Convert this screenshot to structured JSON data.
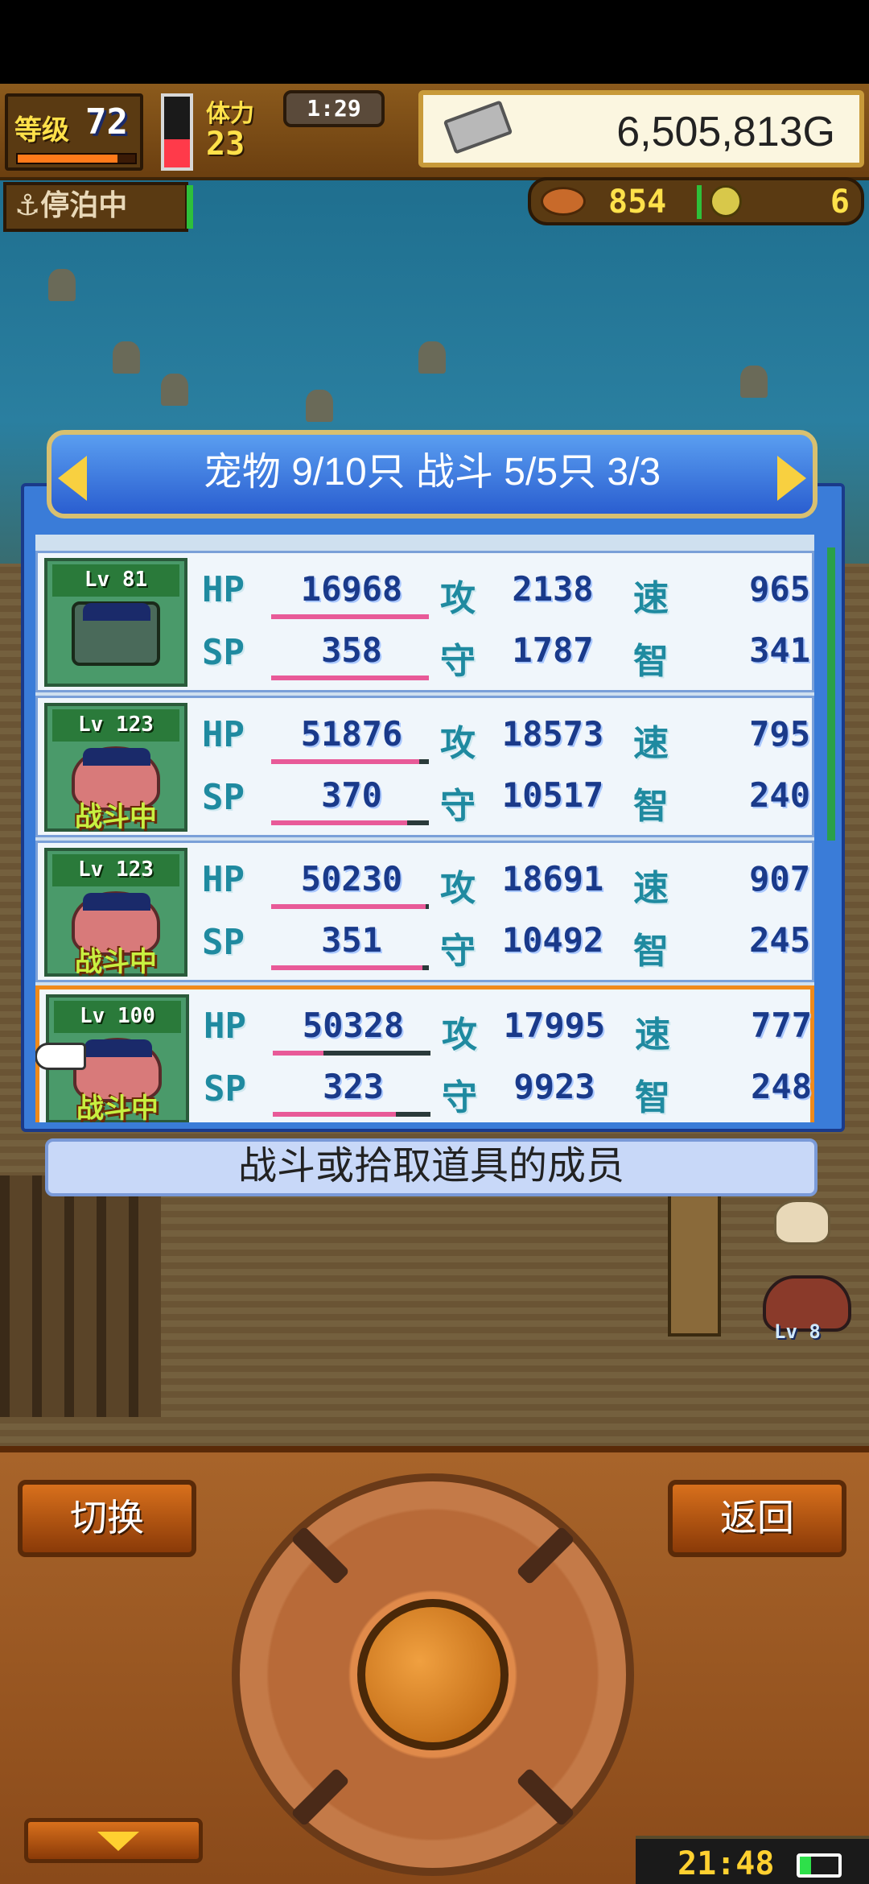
{
  "top": {
    "level_label": "等级",
    "level": "72",
    "exp_fraction": 0.85,
    "stamina_label": "体力",
    "stamina": "23",
    "stamina_fraction": 0.4,
    "timer": "1:29",
    "gold": "6,505,813G"
  },
  "status": {
    "docked": "停泊中",
    "food": "854",
    "coins": "6"
  },
  "dialog": {
    "title": "宠物 9/10只 战斗 5/5只  3/3",
    "hint": "战斗或拾取道具的成员"
  },
  "labels": {
    "hp": "HP",
    "sp": "SP",
    "atk": "攻",
    "def": "守",
    "spd": "速",
    "int": "智",
    "in_battle": "战斗中"
  },
  "pets": [
    {
      "lv": "Lv 81",
      "hp": "16968",
      "sp": "358",
      "atk": "2138",
      "def": "1787",
      "spd": "965",
      "int": "341",
      "hp_fraction": 1.0,
      "sp_fraction": 1.0,
      "in_battle": false,
      "selected": false
    },
    {
      "lv": "Lv 123",
      "hp": "51876",
      "sp": "370",
      "atk": "18573",
      "def": "10517",
      "spd": "795",
      "int": "240",
      "hp_fraction": 0.94,
      "sp_fraction": 0.86,
      "in_battle": true,
      "selected": false
    },
    {
      "lv": "Lv 123",
      "hp": "50230",
      "sp": "351",
      "atk": "18691",
      "def": "10492",
      "spd": "907",
      "int": "245",
      "hp_fraction": 0.98,
      "sp_fraction": 0.96,
      "in_battle": true,
      "selected": false
    },
    {
      "lv": "Lv 100",
      "hp": "50328",
      "sp": "323",
      "atk": "17995",
      "def": "9923",
      "spd": "777",
      "int": "248",
      "hp_fraction": 0.32,
      "sp_fraction": 0.78,
      "in_battle": true,
      "selected": true
    }
  ],
  "npc_level": "Lv 8",
  "buttons": {
    "switch": "切换",
    "back": "返回"
  },
  "clock": {
    "time": "21:48",
    "battery_fraction": 0.3
  },
  "colors": {
    "dialog_blue": "#3a7cd8",
    "selection_orange": "#f08a1a",
    "bar_pink": "#e85a98",
    "gold_text": "#ffe14a"
  }
}
